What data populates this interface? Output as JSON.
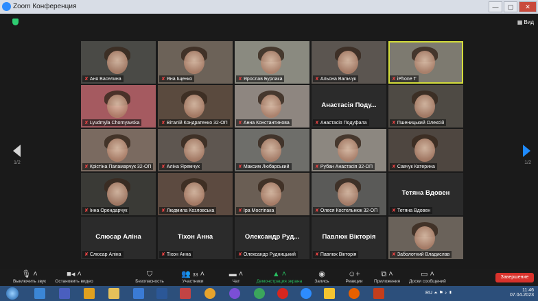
{
  "window": {
    "title": "Zoom Конференция",
    "buttons": [
      "—",
      "▢",
      "✕"
    ]
  },
  "view_button": "Вид",
  "pager": {
    "left": "1/2",
    "right": "1/2"
  },
  "participants": [
    {
      "name": "Аня Васелина",
      "big": "",
      "bg": "#4a4a46"
    },
    {
      "name": "Яна Іщенко",
      "big": "",
      "bg": "#6c6258"
    },
    {
      "name": "Ярослав Бурлака",
      "big": "",
      "bg": "#8a8a80"
    },
    {
      "name": "Альона Вальчук",
      "big": "",
      "bg": "#5b5550"
    },
    {
      "name": "iPhone T",
      "big": "",
      "bg": "#7d7a70",
      "active": true
    },
    {
      "name": "Lyudmyla Chornyavska",
      "big": "",
      "bg": "#a55a60"
    },
    {
      "name": "Віталій Кондратенко 32-ОП",
      "big": "",
      "bg": "#5a4a3e"
    },
    {
      "name": "Анна Константинова",
      "big": "",
      "bg": "#8e8680"
    },
    {
      "name": "Анастасія Подуфала",
      "big": "Анастасія Поду...",
      "bg": "#2b2b2b"
    },
    {
      "name": "Пшеницький Олексій",
      "big": "",
      "bg": "#4e4a44"
    },
    {
      "name": "Крістіна Паламарчук 32-ОП",
      "big": "",
      "bg": "#7a6a60"
    },
    {
      "name": "Аліна Яремчук",
      "big": "",
      "bg": "#5e5650"
    },
    {
      "name": "Максим Любарський",
      "big": "",
      "bg": "#6e6e6a"
    },
    {
      "name": "Рубан Анастасія 32-ОП",
      "big": "",
      "bg": "#8c8780"
    },
    {
      "name": "Савчук Катерина",
      "big": "",
      "bg": "#4e4640"
    },
    {
      "name": "Інна Орендарчук",
      "big": "",
      "bg": "#3a3a36"
    },
    {
      "name": "Людмила Козловська",
      "big": "",
      "bg": "#5c4a40"
    },
    {
      "name": "Іра Мостіпака",
      "big": "",
      "bg": "#6a5e54"
    },
    {
      "name": "Олеся Костельнюк 32-ОП",
      "big": "",
      "bg": "#5a5a58"
    },
    {
      "name": "Тетяна Вдовен",
      "big": "Тетяна Вдовен",
      "bg": "#2b2b2b"
    },
    {
      "name": "Слюсар Аліна",
      "big": "Слюсар Аліна",
      "bg": "#2b2b2b"
    },
    {
      "name": "Тіхон Анна",
      "big": "Тіхон Анна",
      "bg": "#2b2b2b"
    },
    {
      "name": "Олександр Рудницький",
      "big": "Олександр Руд...",
      "bg": "#2b2b2b"
    },
    {
      "name": "Павлюк Вікторія",
      "big": "Павлюк Вікторія",
      "bg": "#2b2b2b"
    },
    {
      "name": "Заболотний Владислав",
      "big": "",
      "bg": "#6a625a"
    }
  ],
  "toolbar": {
    "mute": "Выключить звук",
    "video": "Остановить видео",
    "security": "Безопасность",
    "participants": "Участники",
    "participants_count": "33",
    "chat": "Чат",
    "share": "Демонстрация экрана",
    "record": "Запись",
    "reactions": "Реакции",
    "apps": "Приложения",
    "whiteboard": "Доски сообщений",
    "end": "Завершение"
  },
  "tray": {
    "lang": "RU",
    "time": "11:46",
    "date": "07.04.2023"
  },
  "colors": {
    "accent": "#2d8cff",
    "end": "#d9322c",
    "share": "#27c060",
    "active_border": "#d4dd3a"
  }
}
